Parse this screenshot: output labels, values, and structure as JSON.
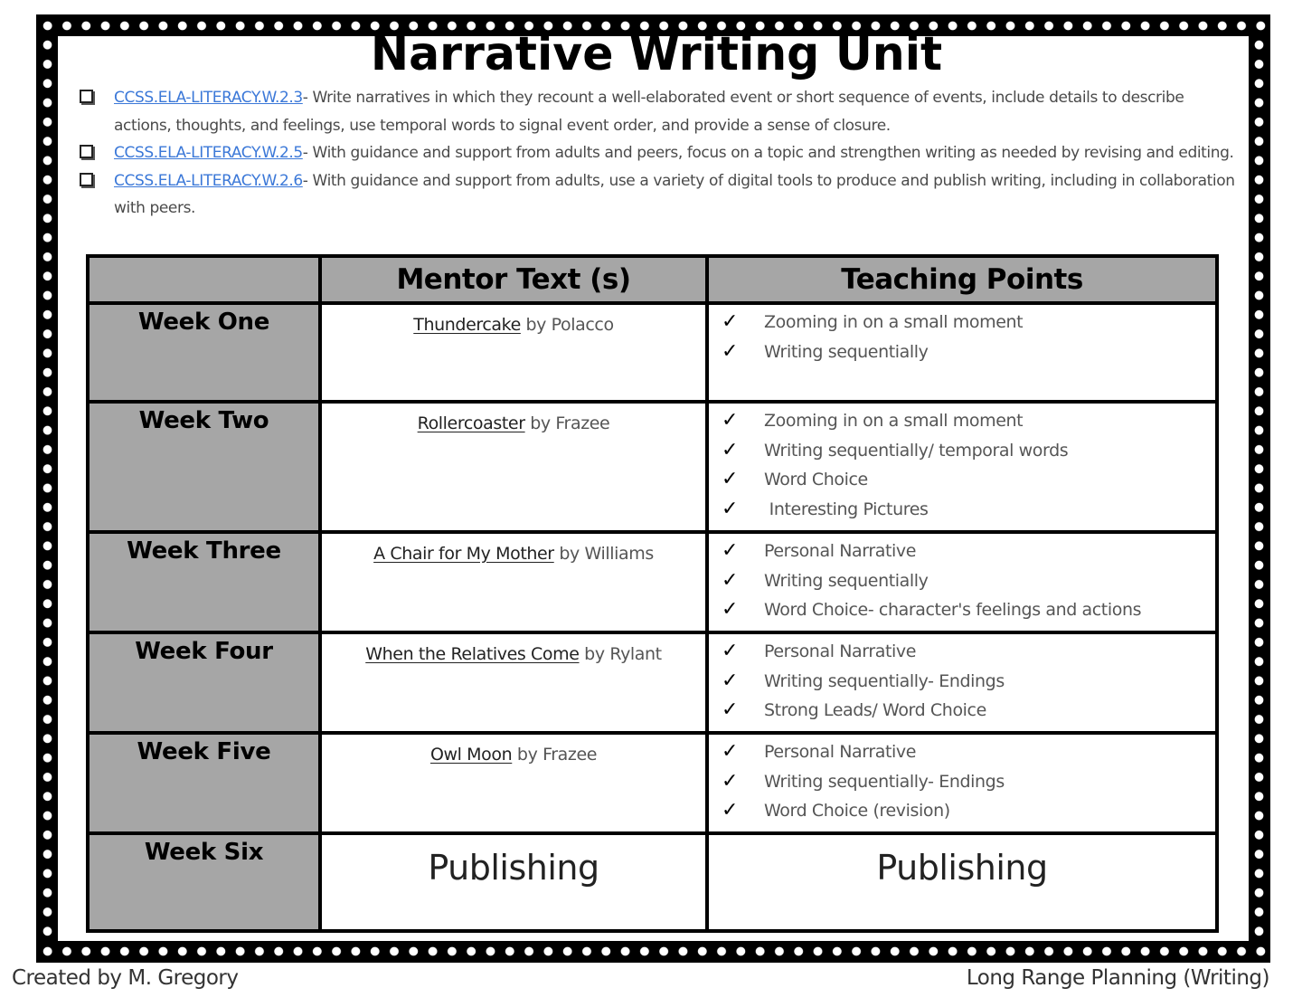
{
  "title": "Narrative Writing Unit",
  "standards": [
    {
      "code": "CCSS.ELA-LITERACY.W.2.3",
      "text": "- Write narratives in which they recount a well-elaborated event or short sequence of events, include details to describe actions, thoughts, and feelings, use temporal words to signal event order, and provide a sense of closure."
    },
    {
      "code": "CCSS.ELA-LITERACY.W.2.5",
      "text": "- With guidance and support from adults and peers, focus on a topic and strengthen writing as needed by revising and editing."
    },
    {
      "code": "CCSS.ELA-LITERACY.W.2.6",
      "text": "- With guidance and support from adults, use a variety of digital tools to produce and publish writing, including in collaboration with peers."
    }
  ],
  "table": {
    "headers": [
      "",
      "Mentor Text (s)",
      "Teaching Points"
    ],
    "rows": [
      {
        "week": "Week One",
        "book": "Thundercake",
        "author": " by Polacco",
        "points": [
          "Zooming in on a small moment",
          "Writing sequentially"
        ]
      },
      {
        "week": "Week Two",
        "book": "Rollercoaster",
        "author": " by Frazee",
        "points": [
          "Zooming in on a small moment",
          "Writing sequentially/ temporal words",
          "Word Choice",
          " Interesting Pictures"
        ]
      },
      {
        "week": "Week Three",
        "book": "A Chair for My Mother",
        "author": " by Williams",
        "points": [
          "Personal Narrative",
          "Writing sequentially",
          "Word Choice- character's feelings and actions"
        ]
      },
      {
        "week": "Week Four",
        "book": "When the Relatives Come",
        "author": " by Rylant",
        "points": [
          "Personal Narrative",
          "Writing sequentially- Endings",
          "Strong Leads/ Word Choice"
        ]
      },
      {
        "week": "Week Five",
        "book": "Owl Moon",
        "author": " by Frazee",
        "points": [
          "Personal Narrative",
          "Writing sequentially- Endings",
          "Word Choice (revision)"
        ]
      },
      {
        "week": "Week Six",
        "mentor_text": "Publishing",
        "teaching_points": "Publishing"
      }
    ]
  },
  "icons": {
    "checkbox": "checkbox-icon",
    "checkmark": "✓"
  },
  "colors": {
    "link": "#3b78d8",
    "header_gray": "#a6a6a6",
    "frame": "#000000"
  },
  "footer": {
    "left": "Created by M. Gregory",
    "right": "Long Range Planning (Writing)"
  }
}
